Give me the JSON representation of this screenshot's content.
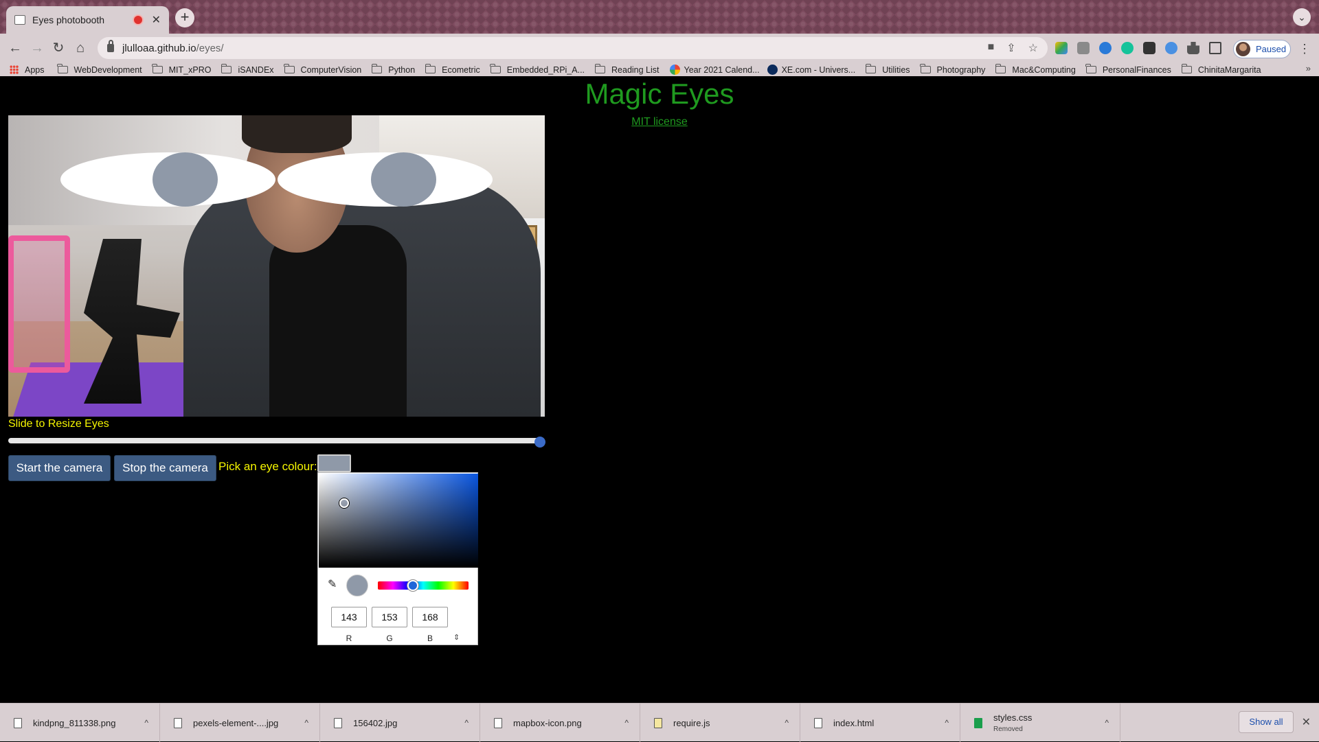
{
  "browser": {
    "tab": {
      "title": "Eyes photobooth",
      "close": "✕"
    },
    "new_tab": "+",
    "tab_search": "⌄",
    "nav": {
      "back": "←",
      "forward": "→",
      "reload": "↻",
      "home": "⌂"
    },
    "url": {
      "host": "jlulloaa.github.io",
      "path": "/eyes/"
    },
    "profile": {
      "label": "Paused"
    },
    "menu": "⋮"
  },
  "bookmarks": [
    {
      "label": "Apps",
      "icon": "apps-grid-icon"
    },
    {
      "label": "WebDevelopment",
      "icon": "folder-icon"
    },
    {
      "label": "MIT_xPRO",
      "icon": "folder-icon"
    },
    {
      "label": "iSANDEx",
      "icon": "folder-icon"
    },
    {
      "label": "ComputerVision",
      "icon": "folder-icon"
    },
    {
      "label": "Python",
      "icon": "folder-icon"
    },
    {
      "label": "Ecometric",
      "icon": "folder-icon"
    },
    {
      "label": "Embedded_RPi_A...",
      "icon": "folder-icon"
    },
    {
      "label": "Reading List",
      "icon": "folder-icon"
    },
    {
      "label": "Year 2021 Calend...",
      "icon": "calendar-icon"
    },
    {
      "label": "XE.com - Univers...",
      "icon": "xe-icon"
    },
    {
      "label": "Utilities",
      "icon": "folder-icon"
    },
    {
      "label": "Photography",
      "icon": "folder-icon"
    },
    {
      "label": "Mac&Computing",
      "icon": "folder-icon"
    },
    {
      "label": "PersonalFinances",
      "icon": "folder-icon"
    },
    {
      "label": "ChinitaMargarita",
      "icon": "folder-icon"
    }
  ],
  "bookmarks_more": "»",
  "page": {
    "title": "Magic Eyes",
    "license_link": "MIT license",
    "slider_label": "Slide to Resize Eyes",
    "slider_value": 1.0,
    "start_button": "Start the camera",
    "stop_button": "Stop the camera",
    "pick_label": "Pick an eye colour:",
    "eye_colour": "#8f99a8"
  },
  "color_picker": {
    "r": "143",
    "g": "153",
    "b": "168",
    "r_label": "R",
    "g_label": "G",
    "b_label": "B",
    "format_toggle": "⇕",
    "hue_fraction": 0.39,
    "eyedropper": "✎"
  },
  "downloads": [
    {
      "name": "kindpng_811338.png",
      "type": "file",
      "sub": ""
    },
    {
      "name": "pexels-element-....jpg",
      "type": "file",
      "sub": ""
    },
    {
      "name": "156402.jpg",
      "type": "file",
      "sub": ""
    },
    {
      "name": "mapbox-icon.png",
      "type": "file",
      "sub": ""
    },
    {
      "name": "require.js",
      "type": "js",
      "sub": ""
    },
    {
      "name": "index.html",
      "type": "html",
      "sub": ""
    },
    {
      "name": "styles.css",
      "type": "css",
      "sub": "Removed"
    }
  ],
  "download_caret": "^",
  "show_all": "Show all",
  "shelf_close": "✕"
}
